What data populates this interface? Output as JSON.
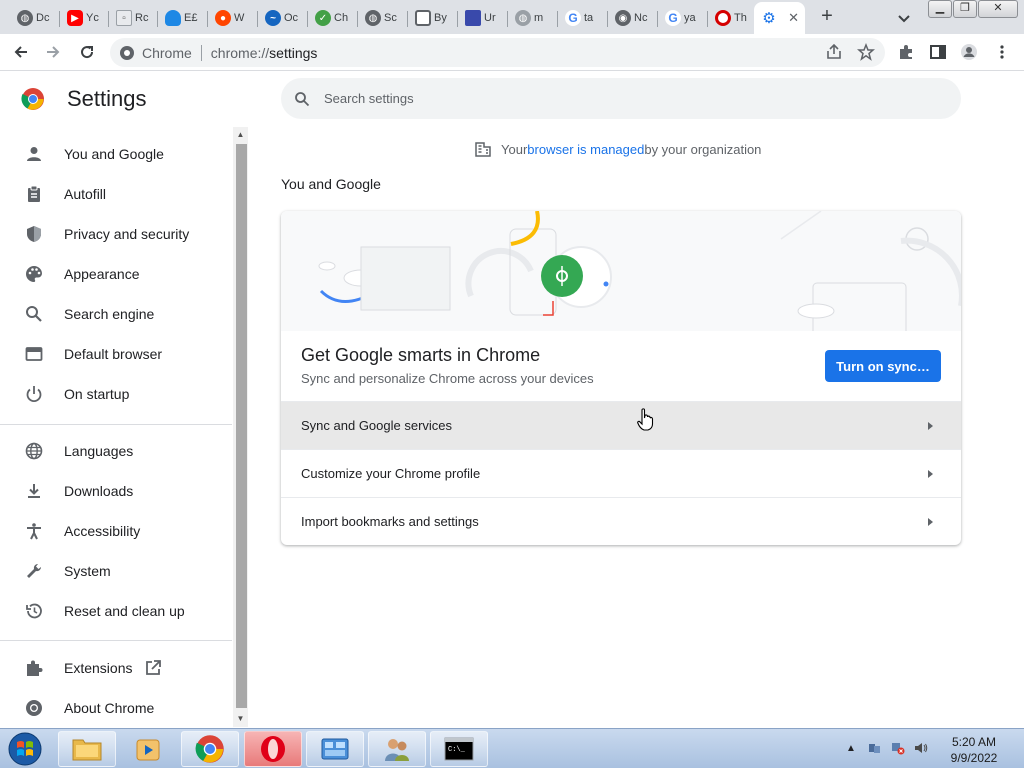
{
  "browser": {
    "tabs": [
      {
        "label": "Dc",
        "icon": "globe-icon"
      },
      {
        "label": "Yc",
        "icon": "youtube-icon"
      },
      {
        "label": "Rc",
        "icon": "image-icon"
      },
      {
        "label": "E£",
        "icon": "cloud-icon"
      },
      {
        "label": "W",
        "icon": "reddit-icon"
      },
      {
        "label": "Oc",
        "icon": "wave-icon"
      },
      {
        "label": "Ch",
        "icon": "tick-icon"
      },
      {
        "label": "Sc",
        "icon": "globe-icon"
      },
      {
        "label": "By",
        "icon": "screenshot-icon"
      },
      {
        "label": "Ur",
        "icon": "bookmark-icon"
      },
      {
        "label": "m",
        "icon": "globe-icon"
      },
      {
        "label": "ta",
        "icon": "google-icon"
      },
      {
        "label": "Nc",
        "icon": "chrome-icon"
      },
      {
        "label": "ya",
        "icon": "google-icon"
      },
      {
        "label": "Th",
        "icon": "opera-icon"
      },
      {
        "label": "",
        "icon": "settings-gear-icon",
        "active": true
      }
    ],
    "omnibox": {
      "chip_label": "Chrome",
      "url_scheme": "chrome://",
      "url_path": "settings"
    }
  },
  "settings": {
    "title": "Settings",
    "search_placeholder": "Search settings",
    "managed": {
      "prefix": "Your ",
      "link": "browser is managed",
      "suffix": " by your organization"
    },
    "sidebar": [
      {
        "label": "You and Google",
        "icon": "person-icon"
      },
      {
        "label": "Autofill",
        "icon": "clipboard-icon"
      },
      {
        "label": "Privacy and security",
        "icon": "shield-icon"
      },
      {
        "label": "Appearance",
        "icon": "palette-icon"
      },
      {
        "label": "Search engine",
        "icon": "search-icon"
      },
      {
        "label": "Default browser",
        "icon": "browser-window-icon"
      },
      {
        "label": "On startup",
        "icon": "power-icon"
      },
      {
        "label": "Languages",
        "icon": "globe-icon"
      },
      {
        "label": "Downloads",
        "icon": "download-icon"
      },
      {
        "label": "Accessibility",
        "icon": "accessibility-icon"
      },
      {
        "label": "System",
        "icon": "wrench-icon"
      },
      {
        "label": "Reset and clean up",
        "icon": "history-icon"
      },
      {
        "label": "Extensions",
        "icon": "puzzle-icon"
      },
      {
        "label": "About Chrome",
        "icon": "chrome-icon"
      }
    ],
    "section_title": "You and Google",
    "promo": {
      "title": "Get Google smarts in Chrome",
      "description": "Sync and personalize Chrome across your devices",
      "button": "Turn on sync…"
    },
    "rows": [
      {
        "label": "Sync and Google services"
      },
      {
        "label": "Customize your Chrome profile"
      },
      {
        "label": "Import bookmarks and settings"
      }
    ]
  },
  "taskbar": {
    "apps": [
      "file-explorer-icon",
      "media-player-icon",
      "chrome-icon",
      "opera-icon",
      "control-panel-icon",
      "users-icon",
      "command-prompt-icon"
    ],
    "clock": {
      "time": "5:20 AM",
      "date": "9/9/2022"
    }
  },
  "colors": {
    "accent": "#1a73e8",
    "tabstrip": "#dee1e6",
    "sync_green": "#34a853"
  }
}
